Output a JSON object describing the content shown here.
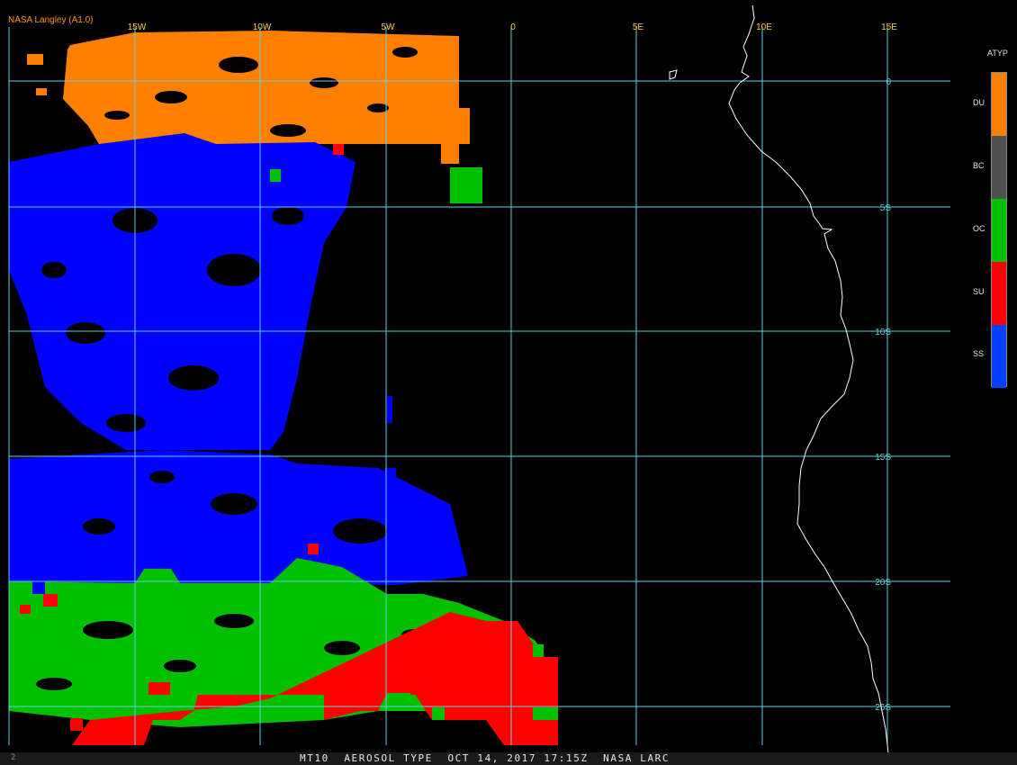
{
  "header": {
    "credit": "NASA Langley (A1.0)"
  },
  "footer": {
    "text": "MT10  AEROSOL TYPE  OCT 14, 2017 17:15Z  NASA LARC",
    "corner_mark": "2"
  },
  "map": {
    "lon_labels": [
      "15W",
      "10W",
      "5W",
      "0",
      "5E",
      "10E",
      "15E"
    ],
    "lat_labels": [
      "0",
      "5S",
      "10S",
      "15S",
      "20S",
      "25S"
    ],
    "grid_color": "#5ed0e0",
    "coastline_color": "#ffffff"
  },
  "legend": {
    "title": "ATYP",
    "items": [
      {
        "code": "DU",
        "color": "#ff8000"
      },
      {
        "code": "BC",
        "color": "#505050"
      },
      {
        "code": "OC",
        "color": "#00c000"
      },
      {
        "code": "SU",
        "color": "#ff0000"
      },
      {
        "code": "SS",
        "color": "#0040ff"
      }
    ]
  }
}
